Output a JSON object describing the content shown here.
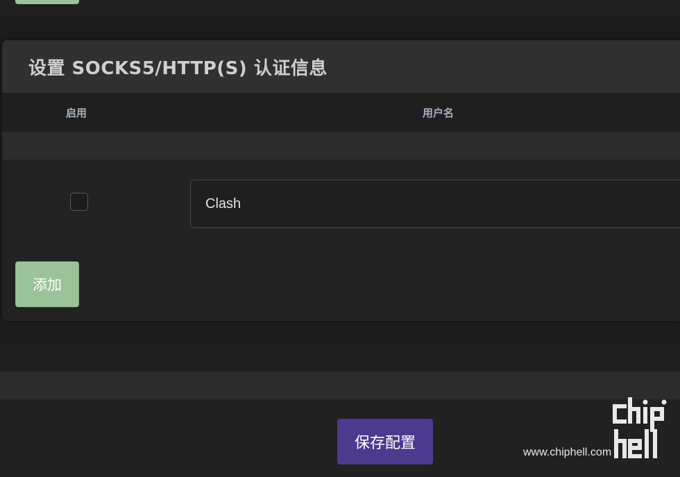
{
  "section": {
    "title": "设置 SOCKS5/HTTP(S) 认证信息"
  },
  "table": {
    "columns": [
      "启用",
      "用户名"
    ],
    "rows": [
      {
        "enabled": false,
        "username": "Clash"
      }
    ]
  },
  "actions": {
    "add_label": "添加",
    "save_label": "保存配置"
  },
  "watermark": {
    "site": "www.chiphell.com"
  },
  "colors": {
    "add_button": "#9bc39a",
    "save_button": "#4b3a8e",
    "background": "#1b1b1b"
  }
}
